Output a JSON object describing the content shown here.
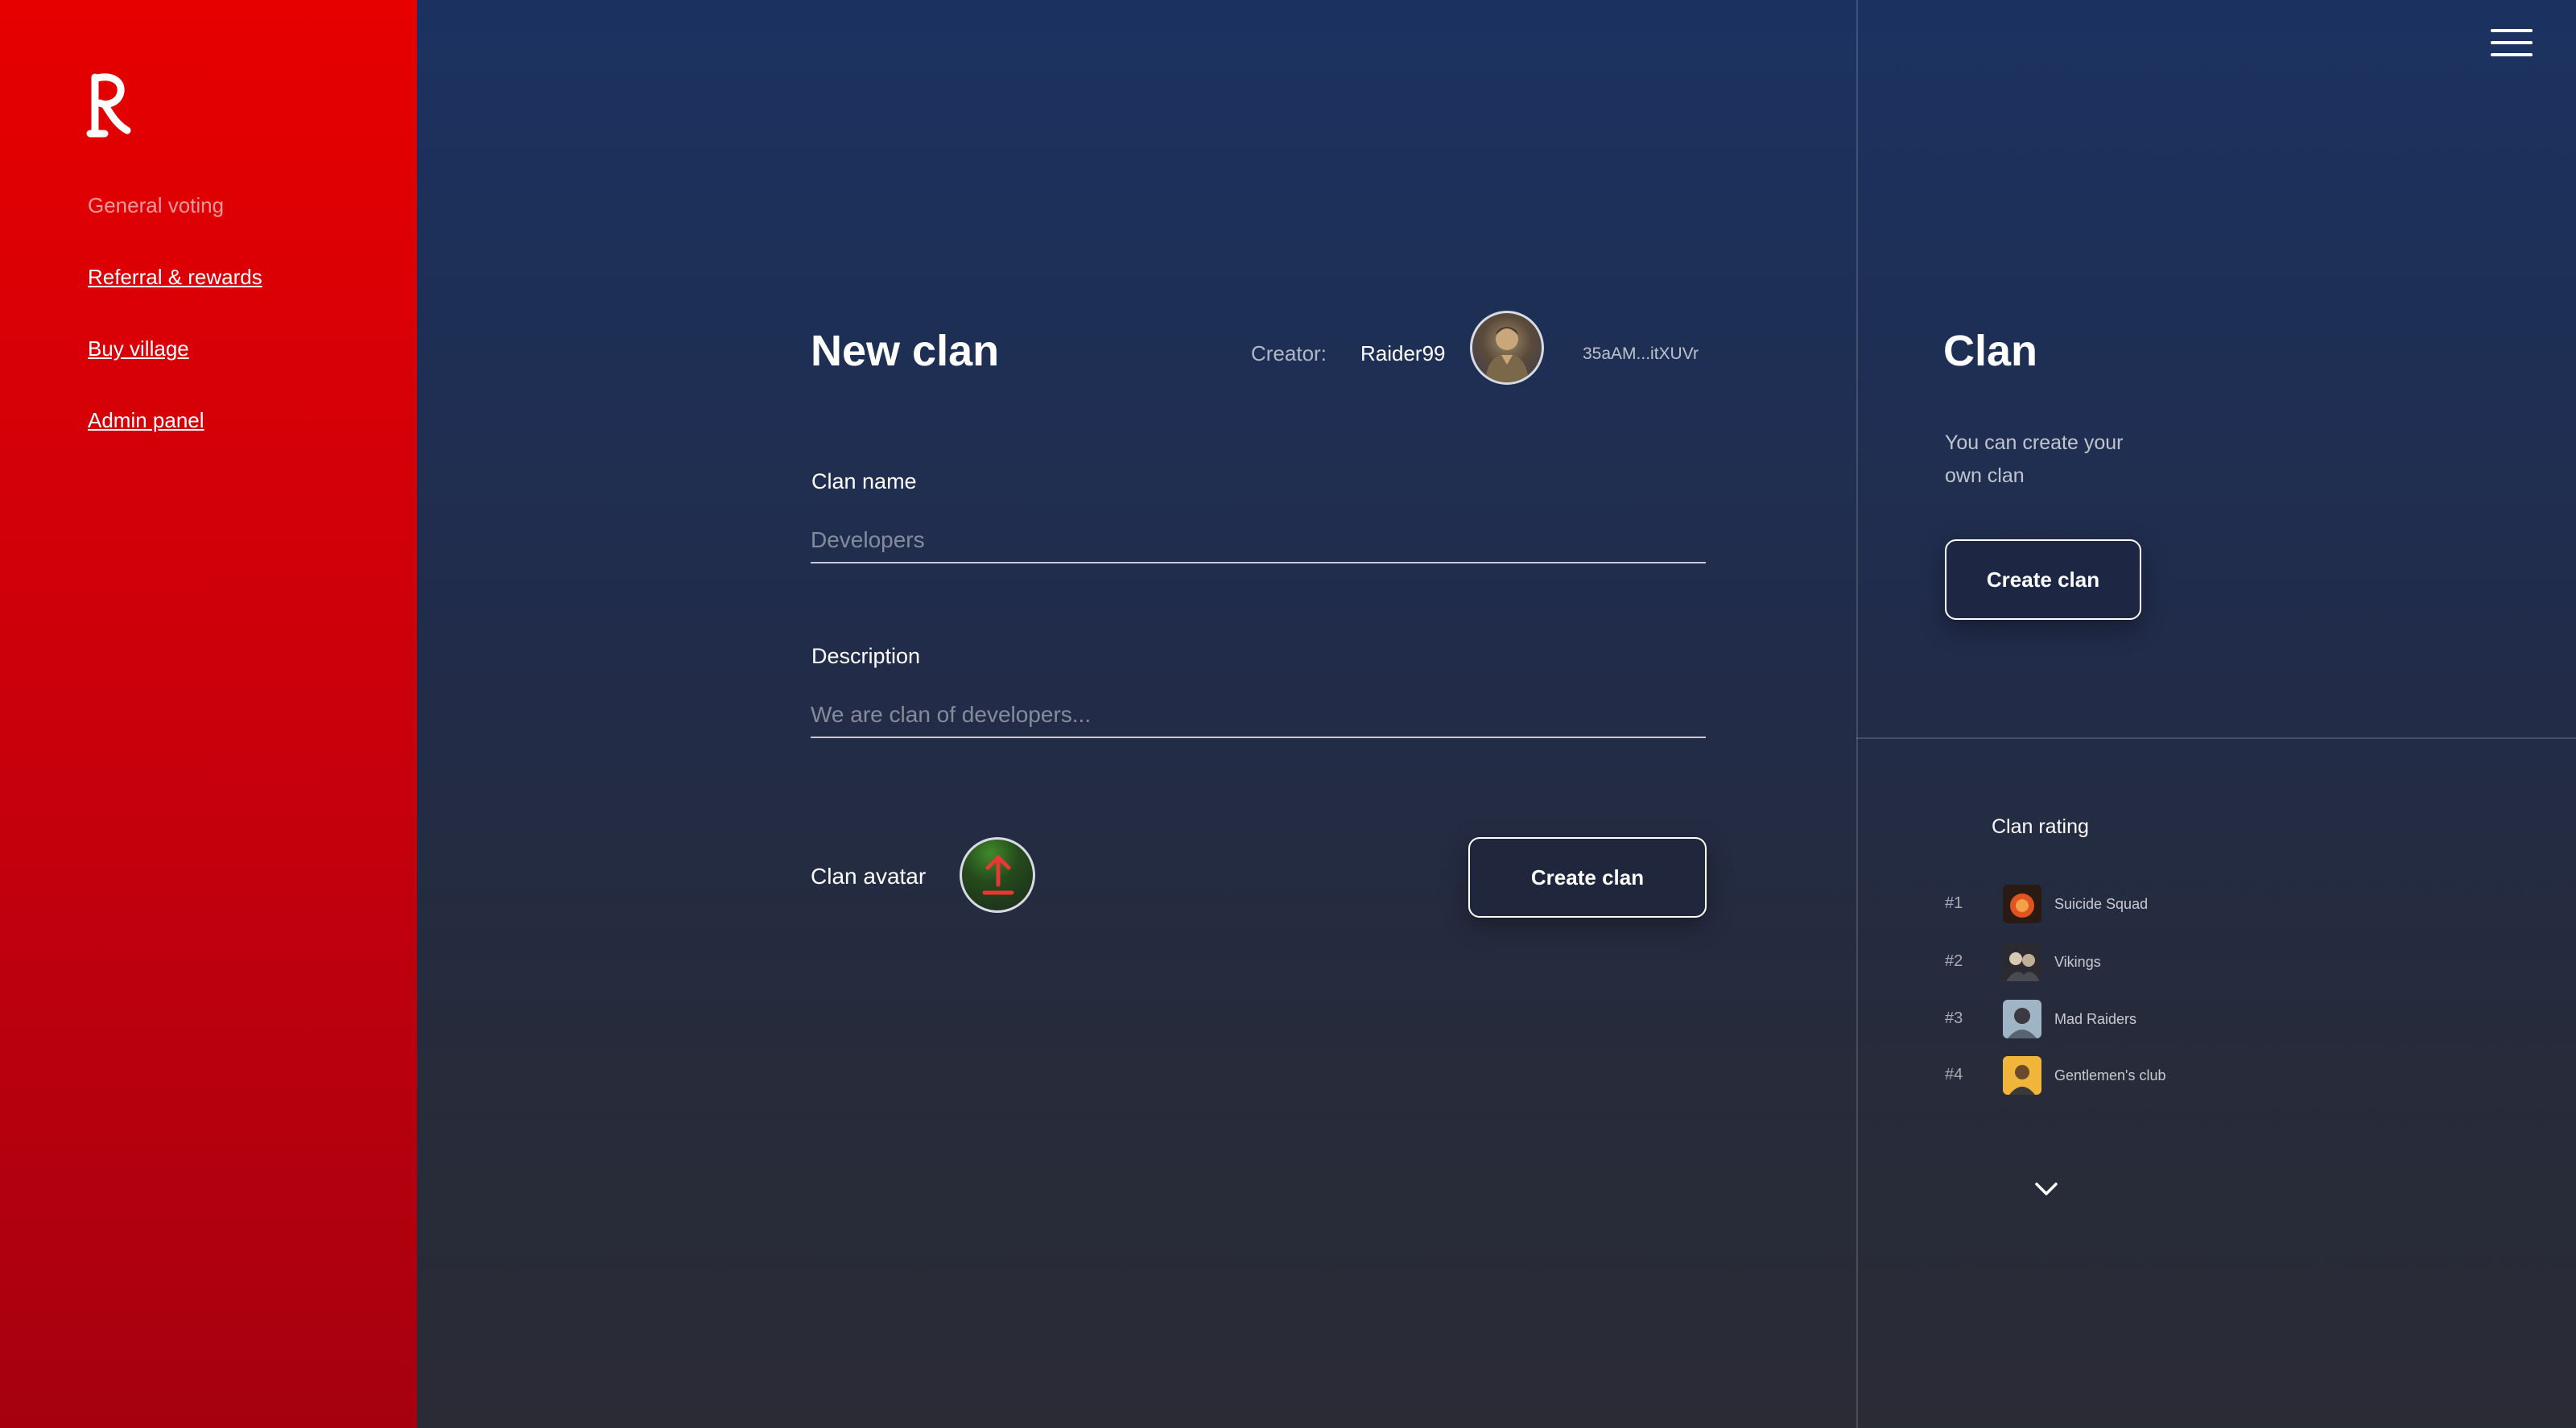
{
  "sidebar": {
    "items": [
      {
        "label": "General voting"
      },
      {
        "label": "Referral & rewards"
      },
      {
        "label": "Buy village"
      },
      {
        "label": "Admin panel"
      }
    ]
  },
  "form": {
    "title": "New clan",
    "creator_label": "Creator:",
    "creator_name": "Raider99",
    "creator_address": "35aAM...itXUVr",
    "clan_name_label": "Clan name",
    "clan_name_placeholder": "Developers",
    "description_label": "Description",
    "description_placeholder": "We are clan of developers...",
    "clan_avatar_label": "Clan avatar",
    "create_button": "Create clan"
  },
  "side": {
    "title": "Clan",
    "text": "You can create your own clan",
    "create_button": "Create clan",
    "rating_title": "Clan rating",
    "clans": [
      {
        "rank": "#1",
        "name": "Suicide Squad"
      },
      {
        "rank": "#2",
        "name": "Vikings"
      },
      {
        "rank": "#3",
        "name": "Mad Raiders"
      },
      {
        "rank": "#4",
        "name": "Gentlemen's club"
      }
    ]
  },
  "colors": {
    "sidebar_red": "#e60000",
    "background_navy": "#1b3261",
    "upload_arrow": "#e53935"
  }
}
